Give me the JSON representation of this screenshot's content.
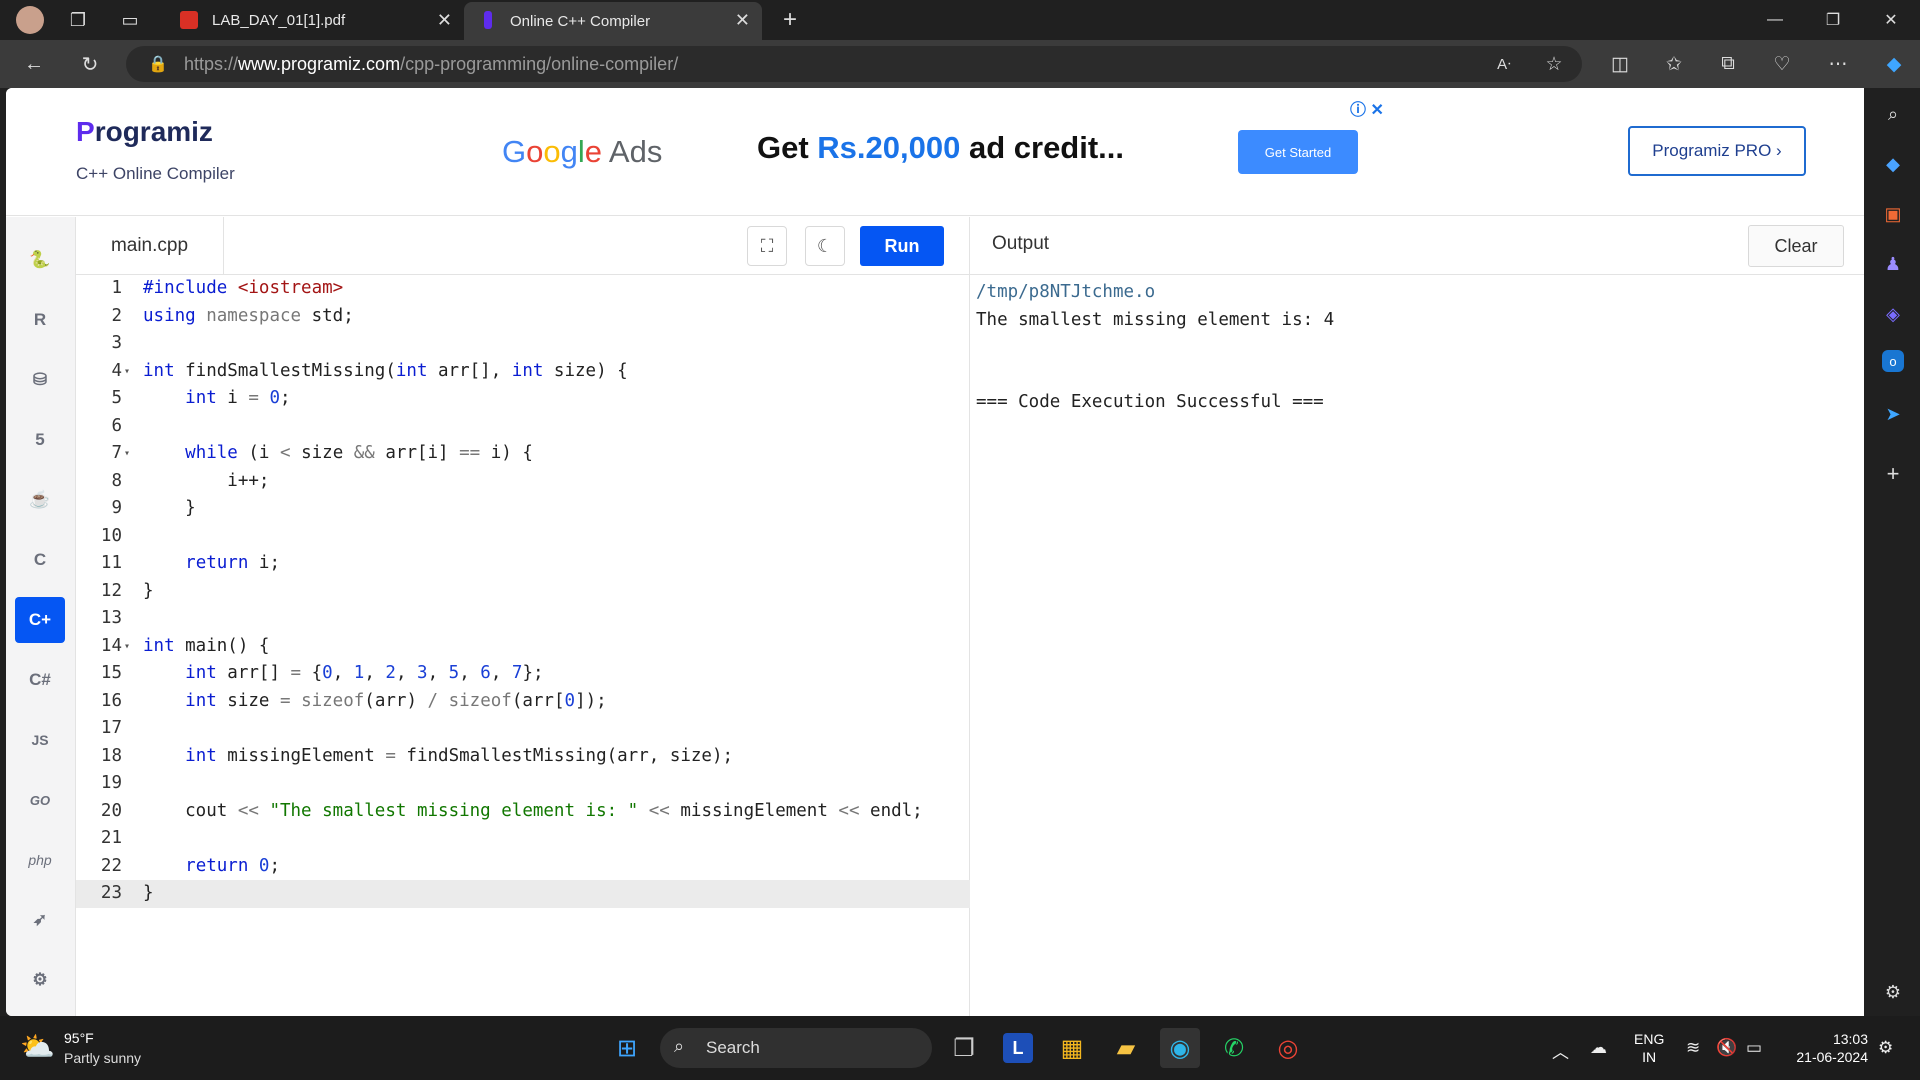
{
  "browser": {
    "tabs": [
      {
        "title": "LAB_DAY_01[1].pdf"
      },
      {
        "title": "Online C++ Compiler"
      }
    ],
    "url_prefix": "https://",
    "url_domain": "www.programiz.com",
    "url_path": "/cpp-programming/online-compiler/"
  },
  "header": {
    "logo_p": "P",
    "logo_rest": "rogramiz",
    "subtitle": "C++ Online Compiler",
    "ad_brand": "Google Ads",
    "ad_text_1": "Get ",
    "ad_text_highlight": "Rs.20,000",
    "ad_text_2": " ad credit...",
    "ad_button": "Get Started",
    "pro_button": "Programiz PRO ›"
  },
  "languages": [
    "python",
    "r",
    "sql",
    "html",
    "java",
    "c",
    "cpp",
    "csharp",
    "js",
    "go",
    "php",
    "swift",
    "rust"
  ],
  "editor": {
    "filename": "main.cpp",
    "run_label": "Run",
    "lines": [
      "#include <iostream>",
      "using namespace std;",
      "",
      "int findSmallestMissing(int arr[], int size) {",
      "    int i = 0;",
      "",
      "    while (i < size && arr[i] == i) {",
      "        i++;",
      "    }",
      "",
      "    return i;",
      "}",
      "",
      "int main() {",
      "    int arr[] = {0, 1, 2, 3, 5, 6, 7};",
      "    int size = sizeof(arr) / sizeof(arr[0]);",
      "",
      "    int missingElement = findSmallestMissing(arr, size);",
      "",
      "    cout << \"The smallest missing element is: \" << missingElement << endl;",
      "",
      "    return 0;",
      "}"
    ],
    "folds": [
      4,
      7,
      14
    ],
    "current_line": 23
  },
  "output": {
    "label": "Output",
    "clear_label": "Clear",
    "lines": [
      "/tmp/p8NTJtchme.o",
      "The smallest missing element is: 4",
      "",
      "",
      "=== Code Execution Successful ==="
    ]
  },
  "taskbar": {
    "temperature": "95°F",
    "weather": "Partly sunny",
    "search_placeholder": "Search",
    "lang_1": "ENG",
    "lang_2": "IN",
    "time": "13:03",
    "date": "21-06-2024"
  },
  "colors": {
    "accent": "#0556f3",
    "keyword": "#0a1dd1",
    "string": "#117700",
    "number": "#1a3fd6",
    "include_path": "#a31515"
  }
}
